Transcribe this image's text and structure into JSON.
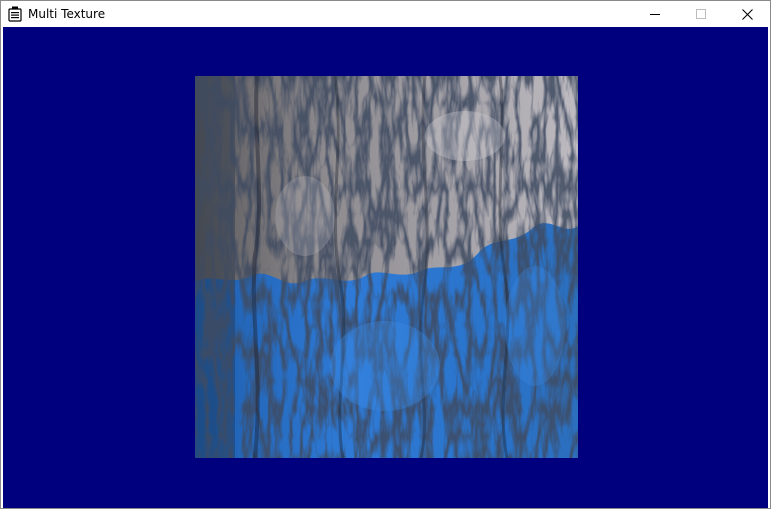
{
  "window": {
    "title": "Multi Texture",
    "app_icon": "window-app-icon",
    "controls": {
      "minimize_icon": "minimize-icon",
      "maximize_icon": "maximize-icon",
      "close_icon": "close-icon"
    }
  },
  "viewport": {
    "background_color": "#00007f",
    "texture": {
      "description_icon": "tree-bark-texture",
      "top_tint": "#8a8a8a",
      "bottom_tint": "#2f7fd8"
    }
  }
}
